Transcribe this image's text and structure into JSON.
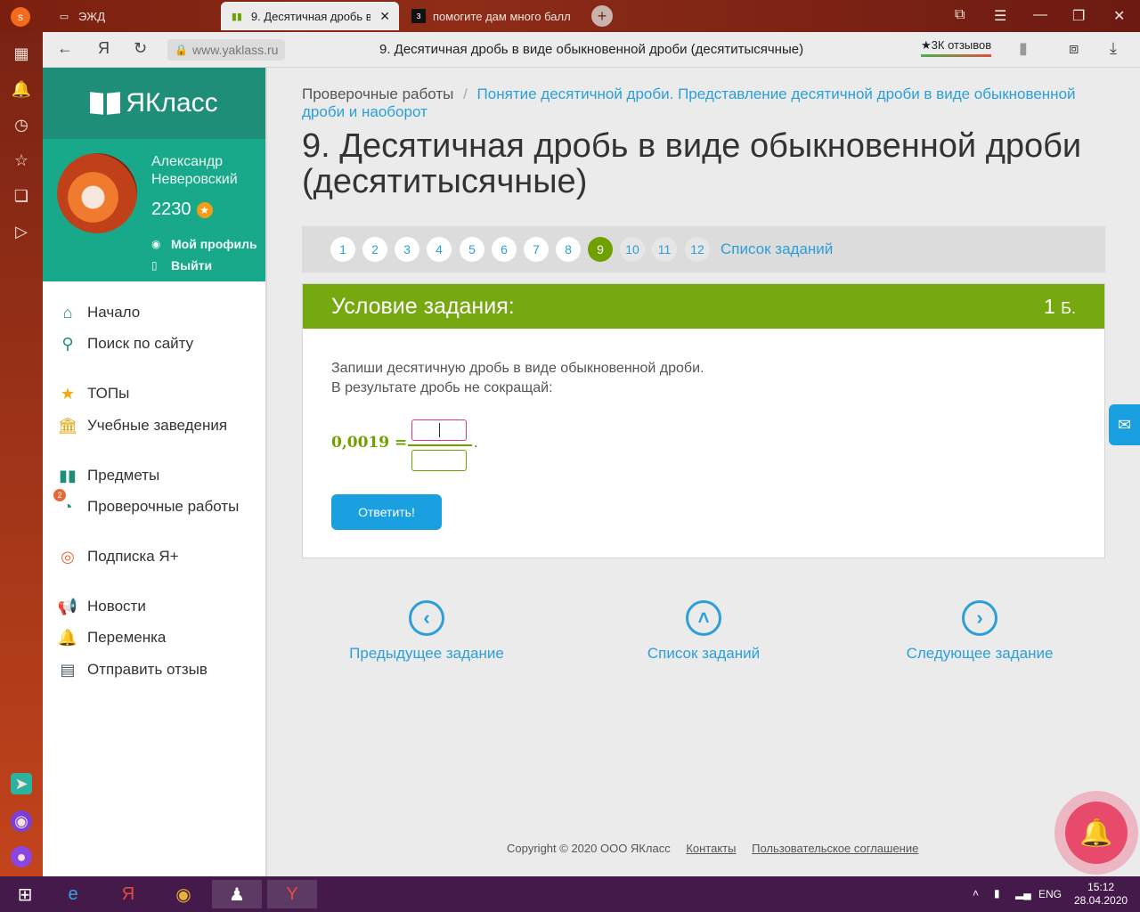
{
  "browser": {
    "tabs": [
      {
        "label": "ЭЖД"
      },
      {
        "label": "9. Десятичная дробь в",
        "active": true
      },
      {
        "label": "помогите дам много балл"
      }
    ],
    "account_badge": "s",
    "url": "www.yaklass.ru",
    "page_title": "9. Десятичная дробь в виде обыкновенной дроби (десятитысячные)",
    "reviews_label": "★3К отзывов"
  },
  "sidebar": {
    "logo_text": "ЯКласс",
    "user_name": "Александр Неверовский",
    "points": "2230",
    "profile_link": "Мой профиль",
    "logout_link": "Выйти",
    "badge_count": "2",
    "nav": [
      {
        "label": "Начало",
        "icon": "home-icon"
      },
      {
        "label": "Поиск по сайту",
        "icon": "search-icon"
      },
      {
        "label": "ТОПы",
        "icon": "star-icon"
      },
      {
        "label": "Учебные заведения",
        "icon": "institution-icon"
      },
      {
        "label": "Предметы",
        "icon": "book-icon"
      },
      {
        "label": "Проверочные работы",
        "icon": "check-icon"
      },
      {
        "label": "Подписка Я+",
        "icon": "subscription-icon"
      },
      {
        "label": "Новости",
        "icon": "megaphone-icon"
      },
      {
        "label": "Переменка",
        "icon": "bell-icon"
      },
      {
        "label": "Отправить отзыв",
        "icon": "feedback-icon"
      }
    ]
  },
  "breadcrumb": {
    "root": "Проверочные работы",
    "separator": "/",
    "topic": "Понятие десятичной дроби. Представление десятичной дроби в виде обыкновенной дроби и наоборот"
  },
  "heading": "9. Десятичная дробь в виде обыкновенной дроби (десятитысячные)",
  "pager": {
    "pages": [
      "1",
      "2",
      "3",
      "4",
      "5",
      "6",
      "7",
      "8",
      "9",
      "10",
      "11",
      "12"
    ],
    "current": "9",
    "list_label": "Список заданий"
  },
  "task": {
    "title": "Условие задания:",
    "points": "1",
    "points_unit": "Б.",
    "line1": "Запиши десятичную дробь в виде обыкновенной дроби.",
    "line2": "В результате дробь не сокращай:",
    "lhs": "0,0019 =",
    "numerator_value": "",
    "denominator_value": "",
    "trailing": ".",
    "submit_label": "Ответить!"
  },
  "bottom_nav": {
    "prev": "Предыдущее задание",
    "list": "Список заданий",
    "next": "Следующее задание"
  },
  "footer": {
    "copyright": "Copyright © 2020 ООО ЯКласс",
    "contacts": "Контакты",
    "agreement": "Пользовательское соглашение"
  },
  "taskbar": {
    "lang": "ENG",
    "time": "15:12",
    "date": "28.04.2020"
  },
  "colors": {
    "brand_green": "#1f8e78",
    "task_header": "#76a810",
    "link_blue": "#2c9fd9",
    "button_blue": "#1aa0e0"
  }
}
